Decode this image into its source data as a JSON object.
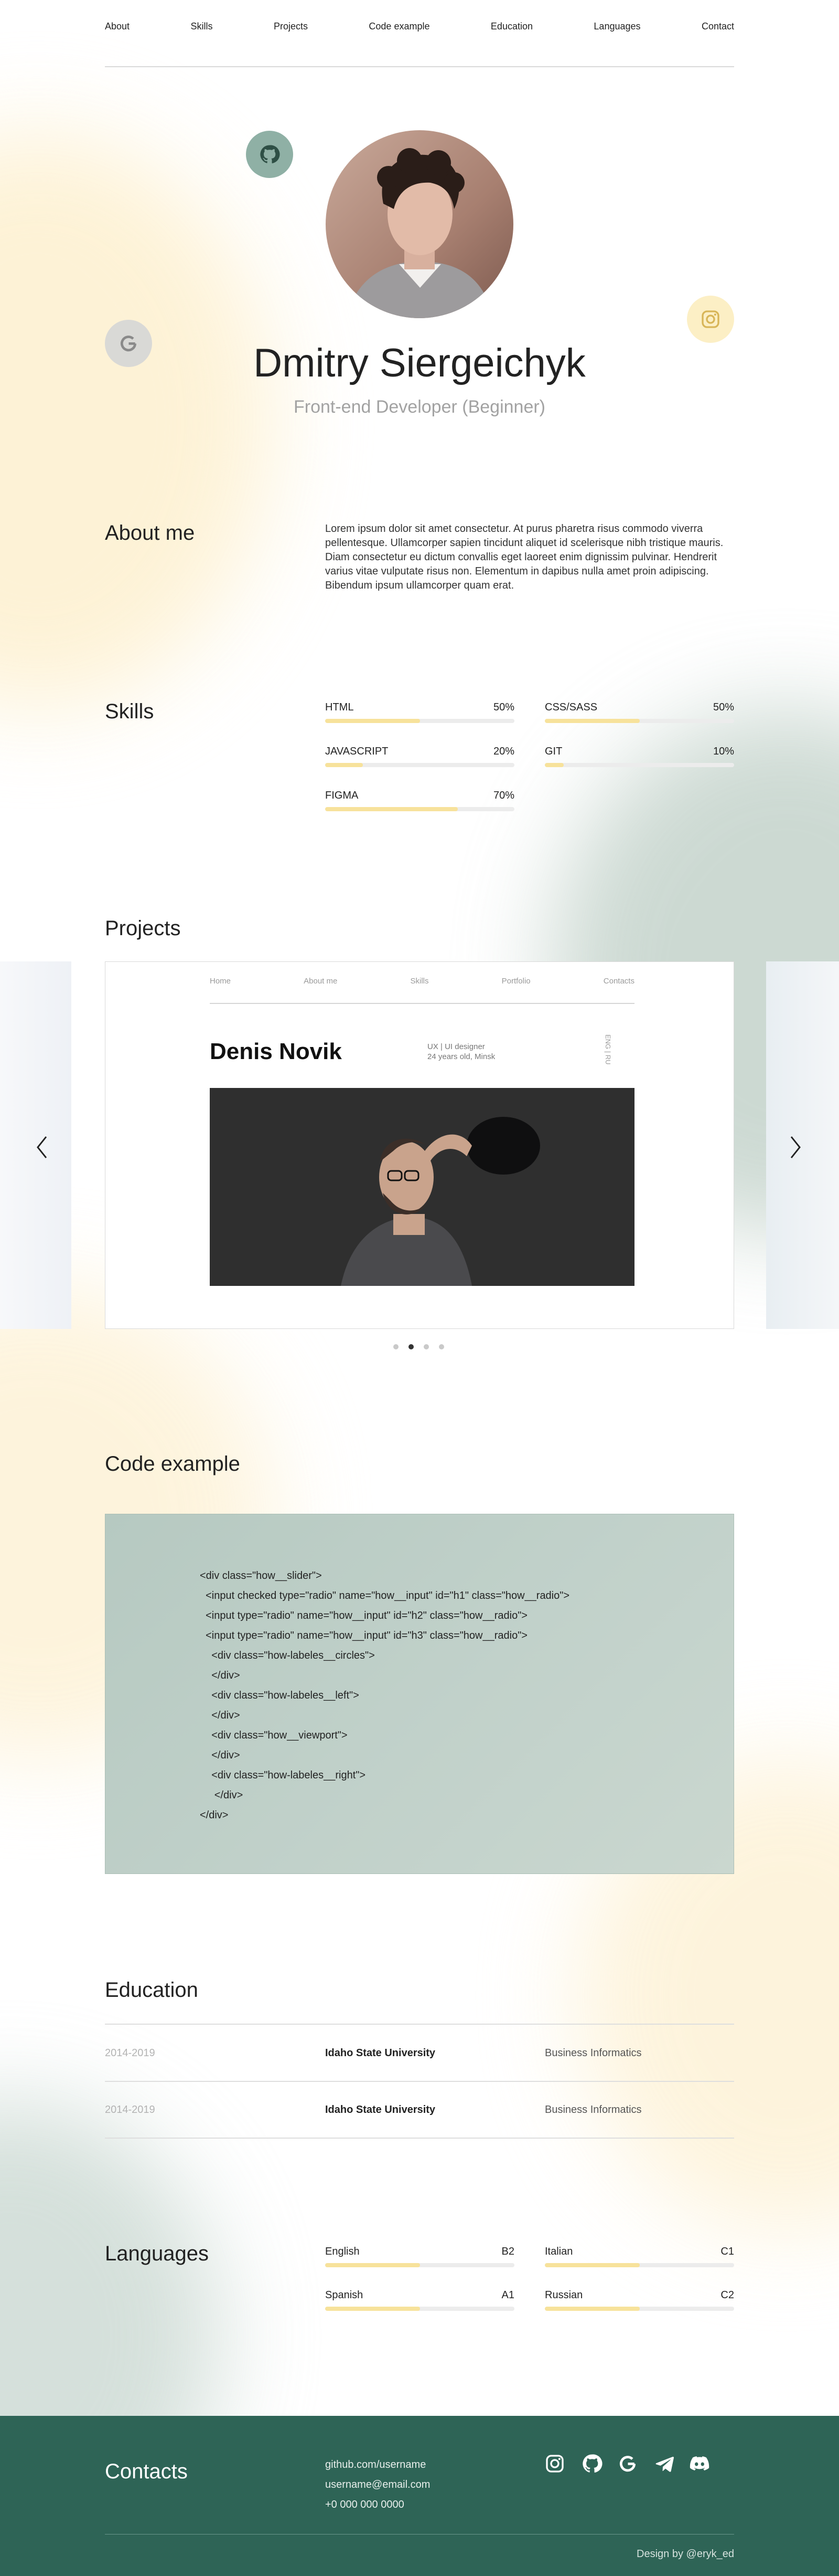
{
  "nav": {
    "items": [
      "About",
      "Skills",
      "Projects",
      "Code example",
      "Education",
      "Languages",
      "Contact"
    ]
  },
  "hero": {
    "name": "Dmitry Siergeichyk",
    "role": "Front-end Developer (Beginner)",
    "social_icons": [
      "github-icon",
      "google-icon",
      "instagram-icon"
    ]
  },
  "about": {
    "title": "About me",
    "text": "Lorem ipsum dolor sit amet consectetur. At purus pharetra risus commodo viverra pellentesque. Ullamcorper sapien tincidunt aliquet id scelerisque nibh tristique mauris. Diam consectetur eu dictum convallis eget laoreet enim dignissim pulvinar. Hendrerit varius vitae vulputate risus non. Elementum in dapibus nulla amet proin adipiscing. Bibendum ipsum ullamcorper quam erat."
  },
  "skills": {
    "title": "Skills",
    "items": [
      {
        "name": "HTML",
        "percent_label": "50%",
        "level": 0.5
      },
      {
        "name": "CSS/SASS",
        "percent_label": "50%",
        "level": 0.5
      },
      {
        "name": "JAVASCRIPT",
        "percent_label": "20%",
        "level": 0.2
      },
      {
        "name": "GIT",
        "percent_label": "10%",
        "level": 0.1
      },
      {
        "name": "FIGMA",
        "percent_label": "70%",
        "level": 0.7
      }
    ]
  },
  "projects": {
    "title": "Projects",
    "slide": {
      "nav": [
        "Home",
        "About me",
        "Skills",
        "Portfolio",
        "Contacts"
      ],
      "name": "Denis Novik",
      "role_line1": "UX | UI designer",
      "role_line2": "24 years old, Minsk",
      "lang": "ENG | RU"
    },
    "dots": 4,
    "active_dot": 2
  },
  "code": {
    "title": "Code example",
    "lines": [
      "<div class=\"how__slider\">",
      "  <input checked type=\"radio\" name=\"how__input\" id=\"h1\" class=\"how__radio\">",
      "  <input type=\"radio\" name=\"how__input\" id=\"h2\" class=\"how__radio\">",
      "  <input type=\"radio\" name=\"how__input\" id=\"h3\" class=\"how__radio\">",
      "    <div class=\"how-labeles__circles\">",
      "    </div>",
      "    <div class=\"how-labeles__left\">",
      "    </div>",
      "    <div class=\"how__viewport\">",
      "    </div>",
      "    <div class=\"how-labeles__right\">",
      "     </div>",
      "</div>"
    ]
  },
  "education": {
    "title": "Education",
    "rows": [
      {
        "years": "2014-2019",
        "school": "Idaho State University",
        "field": "Business Informatics"
      },
      {
        "years": "2014-2019",
        "school": "Idaho State University",
        "field": "Business Informatics"
      }
    ]
  },
  "languages": {
    "title": "Languages",
    "items": [
      {
        "name": "English",
        "level_label": "B2",
        "level": 0.5
      },
      {
        "name": "Italian",
        "level_label": "C1",
        "level": 0.5
      },
      {
        "name": "Spanish",
        "level_label": "A1",
        "level": 0.5
      },
      {
        "name": "Russian",
        "level_label": "C2",
        "level": 0.5
      }
    ]
  },
  "footer": {
    "title": "Contacts",
    "github": "github.com/username",
    "email": "username@email.com",
    "phone": "+0 000 000 0000",
    "icons": [
      "instagram-icon",
      "github-icon",
      "google-icon",
      "telegram-icon",
      "discord-icon"
    ],
    "credit": "Design by @eryk_ed"
  },
  "colors": {
    "accent_bar": "#f7e29b",
    "footer_bg": "#2e6456",
    "code_bg": "#bccdc5",
    "muted_text": "#a2a2a2"
  }
}
